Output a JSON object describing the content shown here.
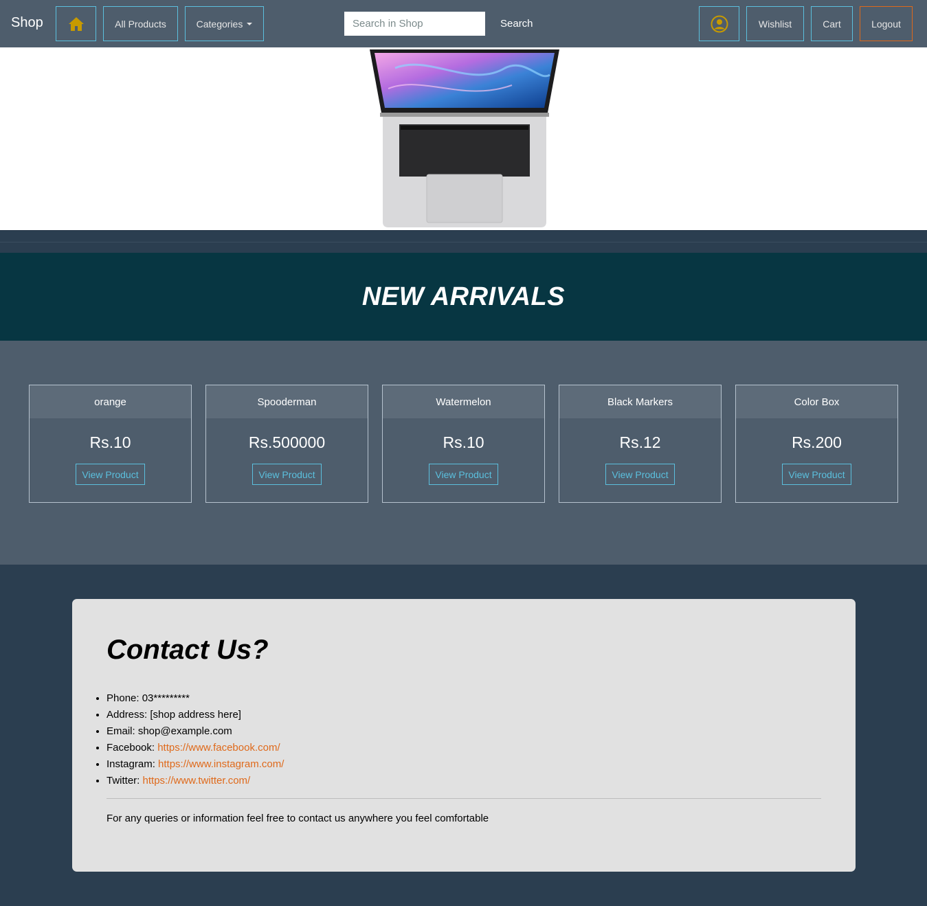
{
  "navbar": {
    "brand": "Shop",
    "home_icon": "home-icon",
    "all_products_label": "All Products",
    "categories_label": "Categories",
    "search_placeholder": "Search in Shop",
    "search_label": "Search",
    "account_icon": "user-circle-icon",
    "wishlist_label": "Wishlist",
    "cart_label": "Cart",
    "logout_label": "Logout"
  },
  "hero": {
    "image": "laptop-image"
  },
  "new_arrivals": {
    "title": "NEW ARRIVALS",
    "products": [
      {
        "name": "orange",
        "price": "Rs.10",
        "button": "View Product"
      },
      {
        "name": "Spooderman",
        "price": "Rs.500000",
        "button": "View Product"
      },
      {
        "name": "Watermelon",
        "price": "Rs.10",
        "button": "View Product"
      },
      {
        "name": "Black Markers",
        "price": "Rs.12",
        "button": "View Product"
      },
      {
        "name": "Color Box",
        "price": "Rs.200",
        "button": "View Product"
      }
    ]
  },
  "contact": {
    "title": "Contact Us?",
    "items": [
      {
        "label": "Phone: ",
        "value": "03*********"
      },
      {
        "label": "Address: ",
        "value": "[shop address here]"
      },
      {
        "label": "Email: ",
        "value": "shop@example.com"
      },
      {
        "label": "Facebook: ",
        "link": "https://www.facebook.com/"
      },
      {
        "label": "Instagram: ",
        "link": "https://www.instagram.com/"
      },
      {
        "label": "Twitter: ",
        "link": "https://www.twitter.com/"
      }
    ],
    "note": "For any queries or information feel free to contact us anywhere you feel comfortable"
  },
  "colors": {
    "navbar": "#4e5d6c",
    "accent_info": "#5bc0de",
    "accent_orange": "#df691a",
    "home_icon": "#c79a00",
    "banner": "#073642",
    "page_bg": "#2b3e50"
  }
}
